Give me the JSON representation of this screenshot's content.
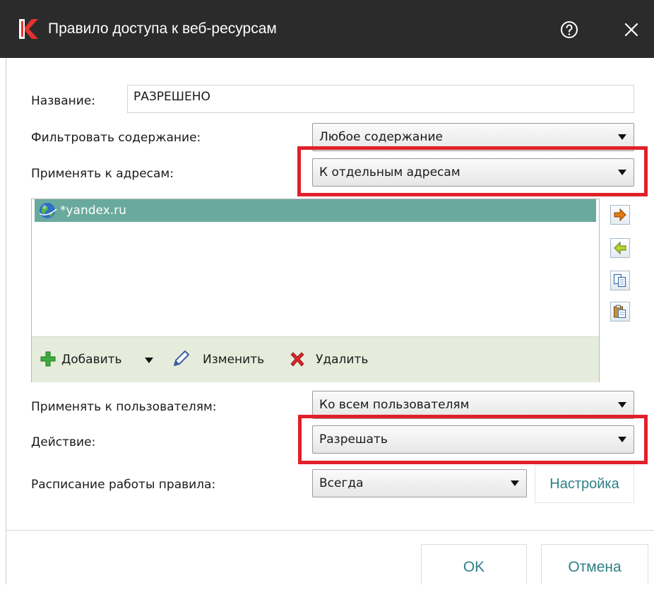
{
  "window": {
    "title": "Правило доступа к веб-ресурсам",
    "icons": {
      "logo": "kaspersky-k-logo",
      "help": "question-circle-icon",
      "close": "close-x-icon"
    }
  },
  "form": {
    "name_label": "Название:",
    "name_value": "РАЗРЕШЕНО",
    "filter_label": "Фильтровать содержание:",
    "filter_value": "Любое содержание",
    "apply_addresses_label": "Применять к адресам:",
    "apply_addresses_value": "К отдельным адресам",
    "address_list": [
      {
        "value": "*yandex.ru",
        "icon": "globe-icon",
        "selected": true
      }
    ],
    "list_toolbar": {
      "add_label": "Добавить",
      "edit_label": "Изменить",
      "delete_label": "Удалить"
    },
    "side_buttons": [
      "arrow-right-icon",
      "arrow-left-icon",
      "copy-icon",
      "paste-icon"
    ],
    "apply_users_label": "Применять к пользователям:",
    "apply_users_value": "Ко всем пользователям",
    "action_label": "Действие:",
    "action_value": "Разрешать",
    "schedule_label": "Расписание работы правила:",
    "schedule_value": "Всегда",
    "schedule_settings_label": "Настройка"
  },
  "footer": {
    "ok_label": "OK",
    "cancel_label": "Отмена"
  },
  "colors": {
    "titlebar": "#2b2b2b",
    "selection": "#6aa99e",
    "list_toolbar": "#e6ecdb",
    "link": "#2e7f86",
    "highlight": "#e0202a"
  }
}
